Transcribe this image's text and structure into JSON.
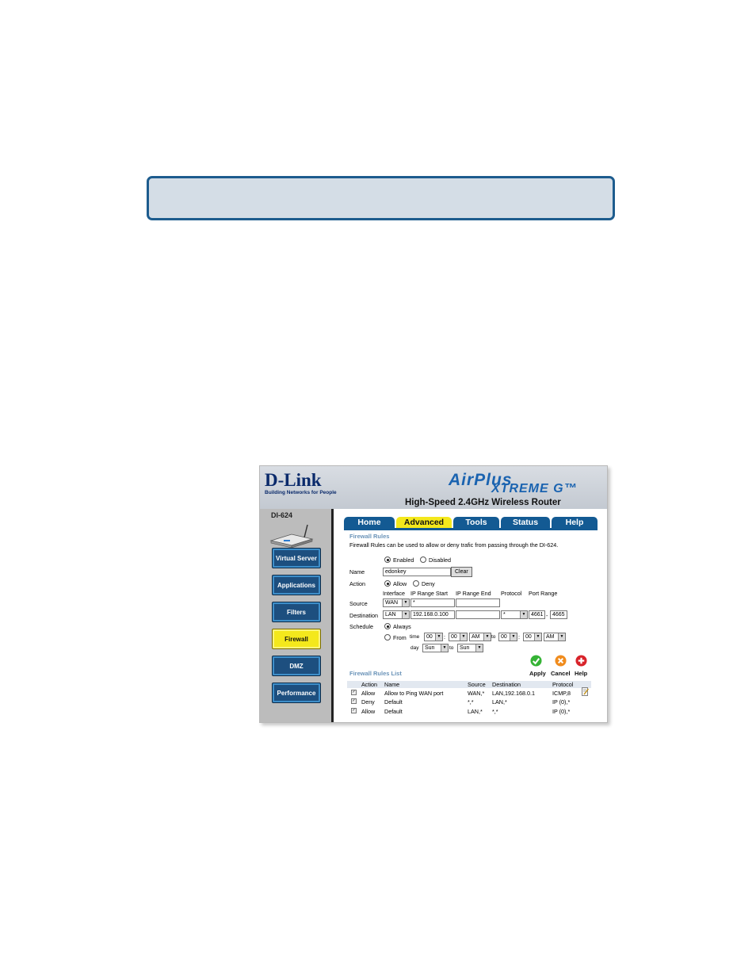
{
  "colors": {
    "banner_border": "#1d5c8e",
    "tab_blue": "#135a93",
    "tab_active": "#f4e81c",
    "section_title": "#6a93b8"
  },
  "header": {
    "logo_main": "D-Link",
    "logo_tag": "Building Networks for People",
    "brand_air": "AirPlus",
    "brand_xtreme": "XTREME G™",
    "product": "High-Speed 2.4GHz Wireless Router"
  },
  "sidebar": {
    "model": "DI-624",
    "items": [
      {
        "label": "Virtual Server"
      },
      {
        "label": "Applications"
      },
      {
        "label": "Filters"
      },
      {
        "label": "Firewall"
      },
      {
        "label": "DMZ"
      },
      {
        "label": "Performance"
      }
    ]
  },
  "tabs": [
    {
      "label": "Home"
    },
    {
      "label": "Advanced"
    },
    {
      "label": "Tools"
    },
    {
      "label": "Status"
    },
    {
      "label": "Help"
    }
  ],
  "form": {
    "title": "Firewall Rules",
    "description": "Firewall Rules can be used to allow or deny trafic from passing through the DI-624.",
    "enabled_label": "Enabled",
    "disabled_label": "Disabled",
    "name_label": "Name",
    "name_value": "edonkey",
    "clear_label": "Clear",
    "action_label": "Action",
    "allow_label": "Allow",
    "deny_label": "Deny",
    "col_interface": "Interface",
    "col_ip_start": "IP Range Start",
    "col_ip_end": "IP Range End",
    "col_protocol": "Protocol",
    "col_port_range": "Port Range",
    "source_label": "Source",
    "source_interface": "WAN",
    "source_ip_start": "*",
    "source_ip_end": "",
    "destination_label": "Destination",
    "dest_interface": "LAN",
    "dest_ip_start": "192.168.0.100",
    "dest_ip_end": "",
    "dest_protocol": "*",
    "dest_port_start": "4661",
    "port_sep": "-",
    "dest_port_end": "4665",
    "schedule_label": "Schedule",
    "always_label": "Always",
    "from_label": "From",
    "time_label": "time",
    "from_hour": "00",
    "from_min": "00",
    "from_ampm": "AM",
    "to_label": "to",
    "time_sep": ":",
    "to_hour": "00",
    "to_min": "00",
    "to_ampm": "AM",
    "day_label": "day",
    "from_day": "Sun",
    "to_day": "Sun"
  },
  "actions": {
    "apply": "Apply",
    "cancel": "Cancel",
    "help": "Help"
  },
  "rules_list": {
    "title": "Firewall Rules List",
    "headers": {
      "action": "Action",
      "name": "Name",
      "source": "Source",
      "destination": "Destination",
      "protocol": "Protocol"
    },
    "rows": [
      {
        "action": "Allow",
        "name": "Allow to Ping WAN port",
        "source": "WAN,*",
        "destination": "LAN,192.168.0.1",
        "protocol": "ICMP,8"
      },
      {
        "action": "Deny",
        "name": "Default",
        "source": "*,*",
        "destination": "LAN,*",
        "protocol": "IP (0),*"
      },
      {
        "action": "Allow",
        "name": "Default",
        "source": "LAN,*",
        "destination": "*,*",
        "protocol": "IP (0),*"
      }
    ]
  }
}
